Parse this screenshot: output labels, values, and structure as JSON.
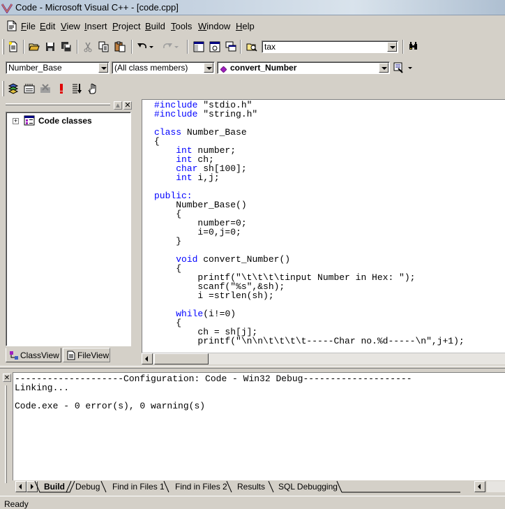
{
  "window": {
    "title": "Code - Microsoft Visual C++ - [code.cpp]"
  },
  "menu": [
    "File",
    "Edit",
    "View",
    "Insert",
    "Project",
    "Build",
    "Tools",
    "Window",
    "Help"
  ],
  "toolbar": {
    "find_combo": "tax",
    "icons": [
      "new-text-file-icon",
      "open-folder-icon",
      "save-icon",
      "save-all-icon",
      "cut-icon",
      "copy-icon",
      "paste-icon",
      "undo-icon",
      "redo-icon",
      "workspace-icon",
      "output-icon",
      "window-list-icon",
      "find-in-files-icon",
      "find-icon"
    ]
  },
  "wizardbar": {
    "class_combo": "Number_Base",
    "filter_combo": "(All class members)",
    "members_combo": "convert_Number"
  },
  "buildbar": {
    "icons": [
      "compile-icon",
      "build-icon",
      "stop-build-icon",
      "execute-icon",
      "go-icon",
      "insert-breakpoint-icon"
    ]
  },
  "workspace": {
    "tree_root": "Code classes",
    "tabs": [
      "ClassView",
      "FileView"
    ]
  },
  "editor": {
    "lines": [
      [
        {
          "t": "#include",
          "k": 1
        },
        {
          "t": " \"stdio.h\"",
          "k": 0
        }
      ],
      [
        {
          "t": "#include",
          "k": 1
        },
        {
          "t": " \"string.h\"",
          "k": 0
        }
      ],
      [
        {
          "t": "",
          "k": 0
        }
      ],
      [
        {
          "t": "class",
          "k": 1
        },
        {
          "t": " Number_Base",
          "k": 0
        }
      ],
      [
        {
          "t": "{",
          "k": 0
        }
      ],
      [
        {
          "t": "    ",
          "k": 0
        },
        {
          "t": "int",
          "k": 1
        },
        {
          "t": " number;",
          "k": 0
        }
      ],
      [
        {
          "t": "    ",
          "k": 0
        },
        {
          "t": "int",
          "k": 1
        },
        {
          "t": " ch;",
          "k": 0
        }
      ],
      [
        {
          "t": "    ",
          "k": 0
        },
        {
          "t": "char",
          "k": 1
        },
        {
          "t": " sh[100];",
          "k": 0
        }
      ],
      [
        {
          "t": "    ",
          "k": 0
        },
        {
          "t": "int",
          "k": 1
        },
        {
          "t": " i,j;",
          "k": 0
        }
      ],
      [
        {
          "t": "",
          "k": 0
        }
      ],
      [
        {
          "t": "public:",
          "k": 1
        }
      ],
      [
        {
          "t": "    Number_Base()",
          "k": 0
        }
      ],
      [
        {
          "t": "    {",
          "k": 0
        }
      ],
      [
        {
          "t": "        number=0;",
          "k": 0
        }
      ],
      [
        {
          "t": "        i=0,j=0;",
          "k": 0
        }
      ],
      [
        {
          "t": "    }",
          "k": 0
        }
      ],
      [
        {
          "t": "",
          "k": 0
        }
      ],
      [
        {
          "t": "    ",
          "k": 0
        },
        {
          "t": "void",
          "k": 1
        },
        {
          "t": " convert_Number()",
          "k": 0
        }
      ],
      [
        {
          "t": "    {",
          "k": 0
        }
      ],
      [
        {
          "t": "        printf(\"\\t\\t\\t\\tinput Number in Hex: \");",
          "k": 0
        }
      ],
      [
        {
          "t": "        scanf(\"%s\",&sh);",
          "k": 0
        }
      ],
      [
        {
          "t": "        i =strlen(sh);",
          "k": 0
        }
      ],
      [
        {
          "t": "",
          "k": 0
        }
      ],
      [
        {
          "t": "    ",
          "k": 0
        },
        {
          "t": "while",
          "k": 1
        },
        {
          "t": "(i!=0)",
          "k": 0
        }
      ],
      [
        {
          "t": "    {",
          "k": 0
        }
      ],
      [
        {
          "t": "        ch = sh[j];",
          "k": 0
        }
      ],
      [
        {
          "t": "        printf(\"\\n\\n\\t\\t\\t\\t-----Char no.%d-----\\n\",j+1);",
          "k": 0
        }
      ]
    ]
  },
  "output": {
    "lines": [
      "--------------------Configuration: Code - Win32 Debug--------------------",
      "Linking...",
      "",
      "Code.exe - 0 error(s), 0 warning(s)"
    ],
    "tabs": [
      "Build",
      "Debug",
      "Find in Files 1",
      "Find in Files 2",
      "Results",
      "SQL Debugging"
    ]
  },
  "status": {
    "text": "Ready"
  }
}
